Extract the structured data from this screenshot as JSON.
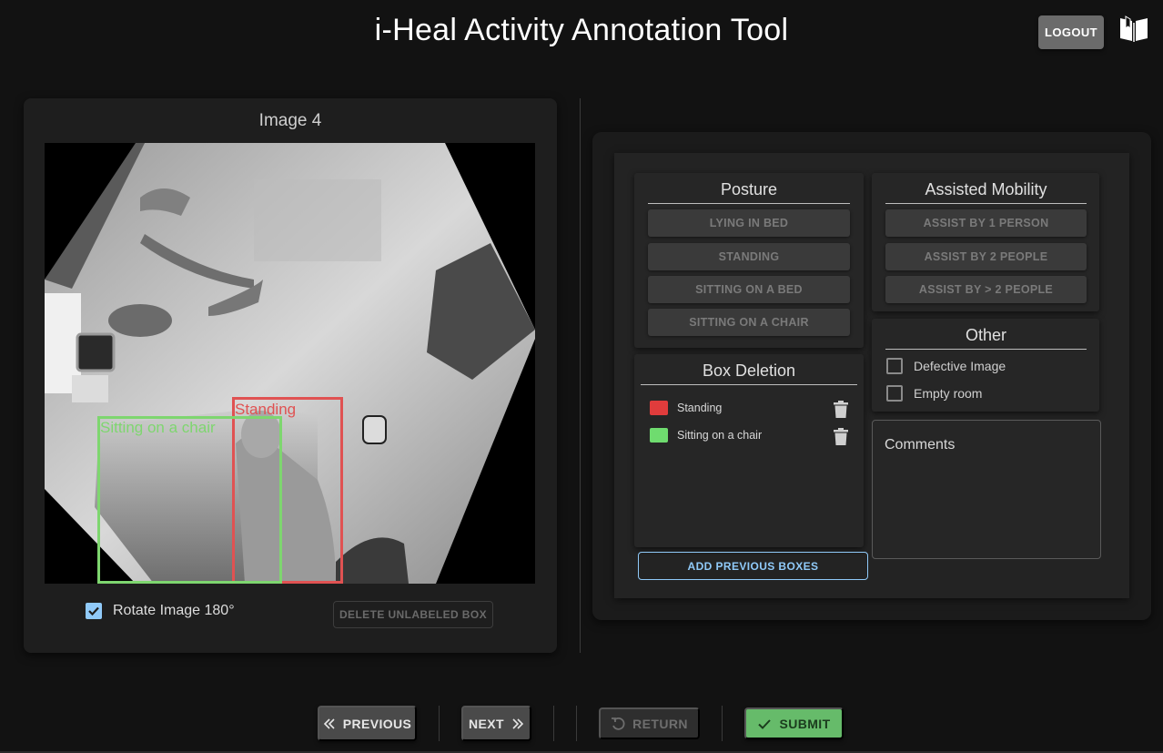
{
  "header": {
    "title": "i-Heal Activity Annotation Tool",
    "logout_label": "LOGOUT",
    "guide_icon": "book-open-icon"
  },
  "image_panel": {
    "title": "Image 4",
    "boxes": [
      {
        "label": "Standing",
        "color": "#e05252"
      },
      {
        "label": "Sitting on a chair",
        "color": "#7ed66f"
      }
    ],
    "rotate_label": "Rotate Image 180°",
    "rotate_checked": true,
    "delete_unlabeled_label": "DELETE UNLABELED BOX"
  },
  "posture": {
    "title": "Posture",
    "options": [
      "LYING IN BED",
      "STANDING",
      "SITTING ON A BED",
      "SITTING ON A CHAIR"
    ]
  },
  "assisted_mobility": {
    "title": "Assisted Mobility",
    "options": [
      "ASSIST BY 1 PERSON",
      "ASSIST BY 2 PEOPLE",
      "ASSIST BY > 2 PEOPLE"
    ]
  },
  "other": {
    "title": "Other",
    "options": [
      {
        "label": "Defective Image",
        "checked": false
      },
      {
        "label": "Empty room",
        "checked": false
      }
    ]
  },
  "box_deletion": {
    "title": "Box Deletion",
    "items": [
      {
        "label": "Standing",
        "color": "#e03c3c"
      },
      {
        "label": "Sitting on a chair",
        "color": "#6fdc6f"
      }
    ],
    "add_previous_label": "ADD PREVIOUS BOXES"
  },
  "comments": {
    "label": "Comments"
  },
  "nav": {
    "previous": "PREVIOUS",
    "next": "NEXT",
    "return": "RETURN",
    "submit": "SUBMIT",
    "submit_color": "#66bb6a"
  }
}
